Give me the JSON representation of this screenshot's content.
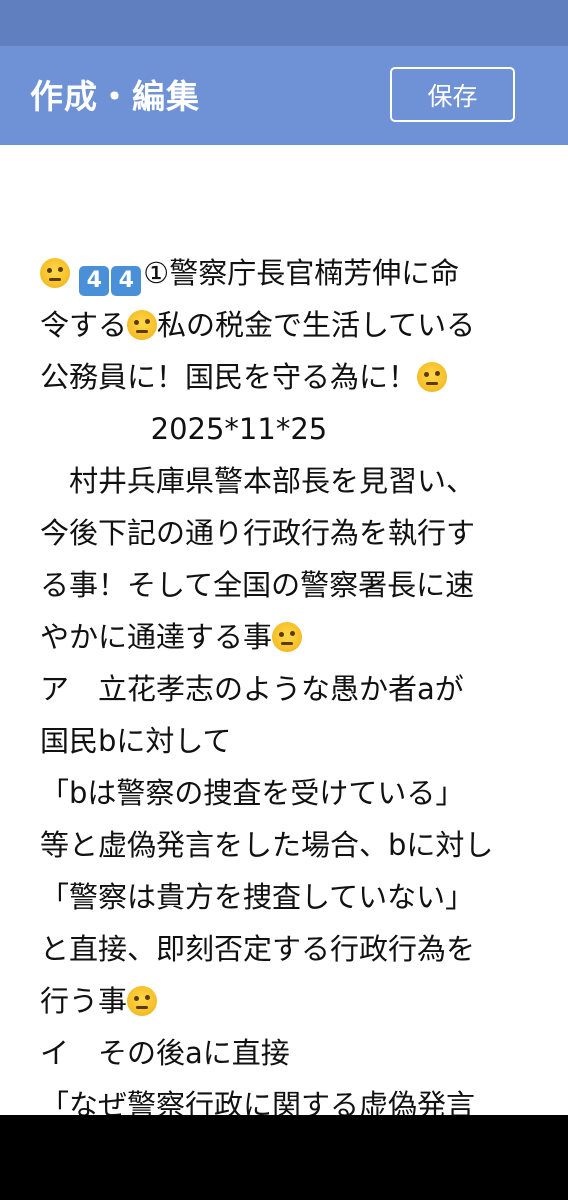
{
  "header": {
    "title": "作成・編集",
    "save_label": "保存"
  },
  "colors": {
    "status_bar": "#5f7fbf",
    "app_bar": "#6f92d6",
    "nav_bar": "#000000"
  },
  "content": {
    "keycap_char": "4",
    "lines": [
      "①警察庁長官楠芳伸に命",
      "令する",
      "私の税金で生活している",
      "公務員に！国民を守る為に！",
      "            2025*11*25",
      "　村井兵庫県警本部長を見習い、",
      "今後下記の通り行政行為を執行す",
      "る事！そして全国の警察署長に速",
      "やかに通達する事",
      "ア　立花孝志のような愚か者aが",
      "国民bに対して",
      "「bは警察の捜査を受けている」",
      "等と虚偽発言をした場合、bに対し",
      "「警察は貴方を捜査していない」",
      "と直接、即刻否定する行政行為を",
      "行う事",
      "イ　その後aに直接",
      "「なぜ警察行政に関する虚偽発言"
    ]
  }
}
